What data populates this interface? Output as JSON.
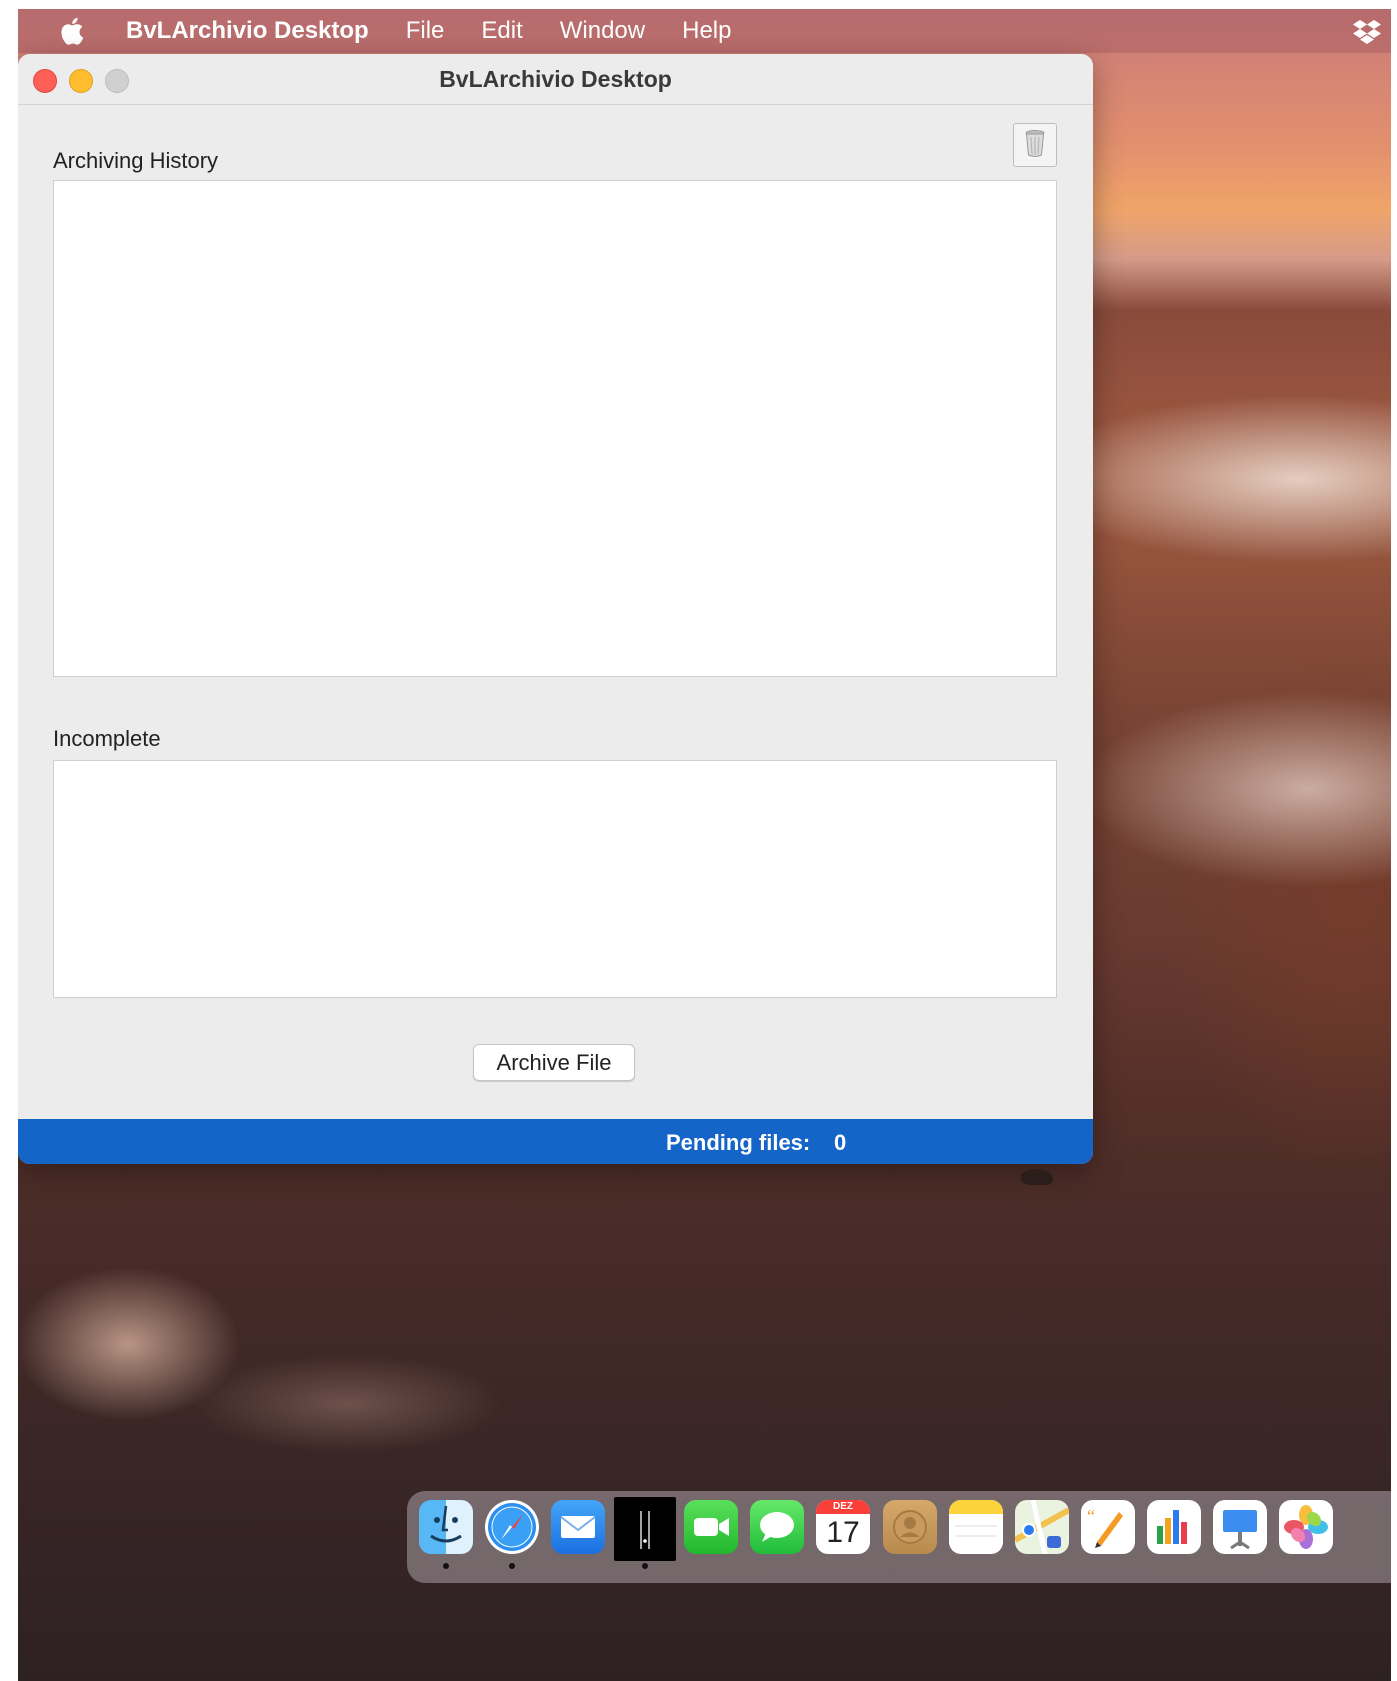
{
  "menubar": {
    "app_name": "BvLArchivio Desktop",
    "items": [
      "File",
      "Edit",
      "Window",
      "Help"
    ]
  },
  "window": {
    "title": "BvLArchivio Desktop",
    "history_label": "Archiving History",
    "incomplete_label": "Incomplete",
    "archive_button_label": "Archive File",
    "status_label": "Pending files:",
    "pending_count": "0"
  },
  "dock": {
    "calendar_month": "DEZ",
    "calendar_day": "17",
    "apps": [
      "finder",
      "safari",
      "mail",
      "terminal",
      "facetime",
      "messages",
      "calendar",
      "contacts",
      "notes",
      "maps",
      "pages",
      "numbers",
      "keynote",
      "photos"
    ]
  },
  "colors": {
    "status_bar": "#1565c9",
    "window_bg": "#ececec",
    "close": "#fe5f57",
    "minimize": "#febc2e"
  }
}
